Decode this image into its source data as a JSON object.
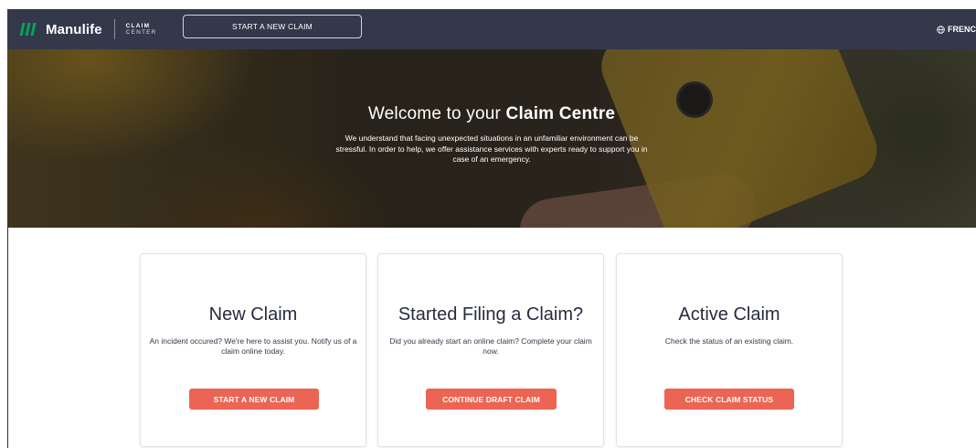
{
  "header": {
    "brand_name": "Manulife",
    "brand_sub_line1": "CLAIM",
    "brand_sub_line2": "CENTER",
    "start_claim_label": "START A NEW CLAIM",
    "language_label": "FRENC"
  },
  "hero": {
    "title_prefix": "Welcome to your ",
    "title_emphasis": "Claim Centre",
    "description": "We understand that facing unexpected situations in an unfamiliar environment can be stressful. In order to help, we offer assistance services with experts ready to support you in case of an emergency."
  },
  "cards": [
    {
      "title": "New Claim",
      "description": "An incident occured? We're here to assist you. Notify us of a claim online today.",
      "button_label": "START A NEW CLAIM"
    },
    {
      "title": "Started Filing a Claim?",
      "description": "Did you already start an online claim? Complete your claim now.",
      "button_label": "CONTINUE DRAFT CLAIM"
    },
    {
      "title": "Active Claim",
      "description": "Check the status of an existing claim.",
      "button_label": "CHECK CLAIM STATUS"
    }
  ],
  "colors": {
    "header_bg": "#34384b",
    "brand_green": "#00a758",
    "accent_coral": "#ec6453"
  },
  "icons": {
    "brand_mark": "manulife-logo-icon",
    "language": "globe-icon"
  }
}
